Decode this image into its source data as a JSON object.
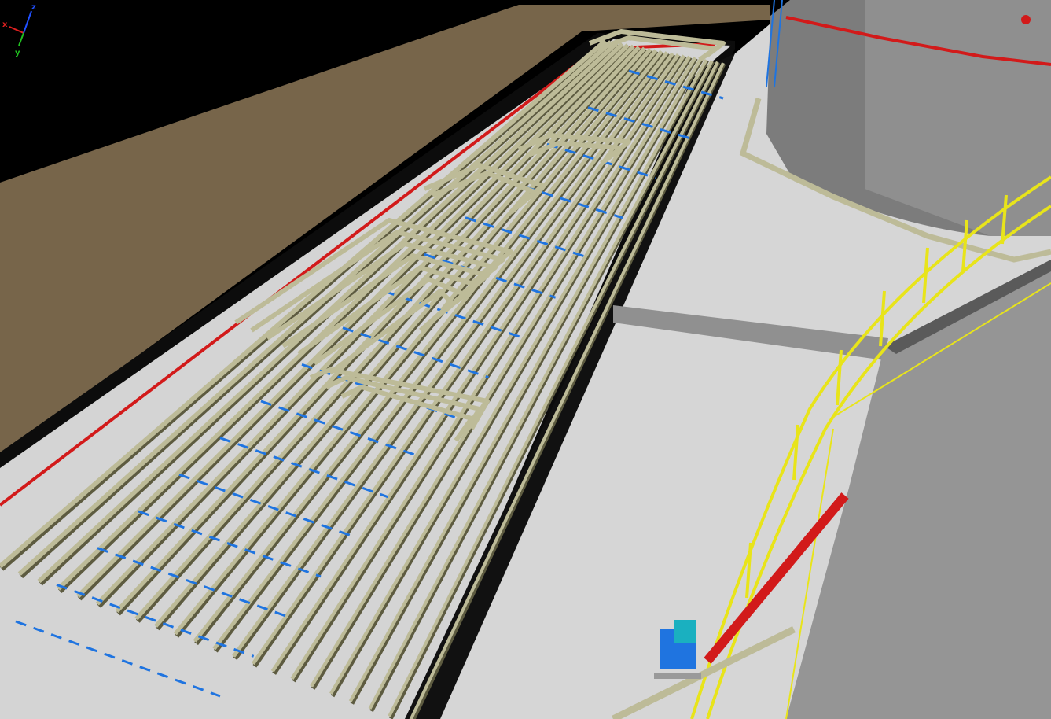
{
  "viewport": {
    "background_color": "#000000",
    "ground_color": "#77654a",
    "deck_color": "#d9d9d9",
    "deck_edge_color": "#0c0c0c",
    "pipe_color": "#bdbb98",
    "pipe_edge_color": "#5d5b40",
    "support_color": "#1f74e0",
    "red_pipe_color": "#d21a1a",
    "rail_color": "#e8e41a",
    "tank_color": "#8c8c8c",
    "tank_dark_color": "#6f6f6f",
    "equipment_color": "#1ab0c0"
  },
  "axis_triad": {
    "x_label": "x",
    "y_label": "y",
    "z_label": "z",
    "x_color": "#e02020",
    "y_color": "#20c020",
    "z_color": "#2050ff"
  }
}
